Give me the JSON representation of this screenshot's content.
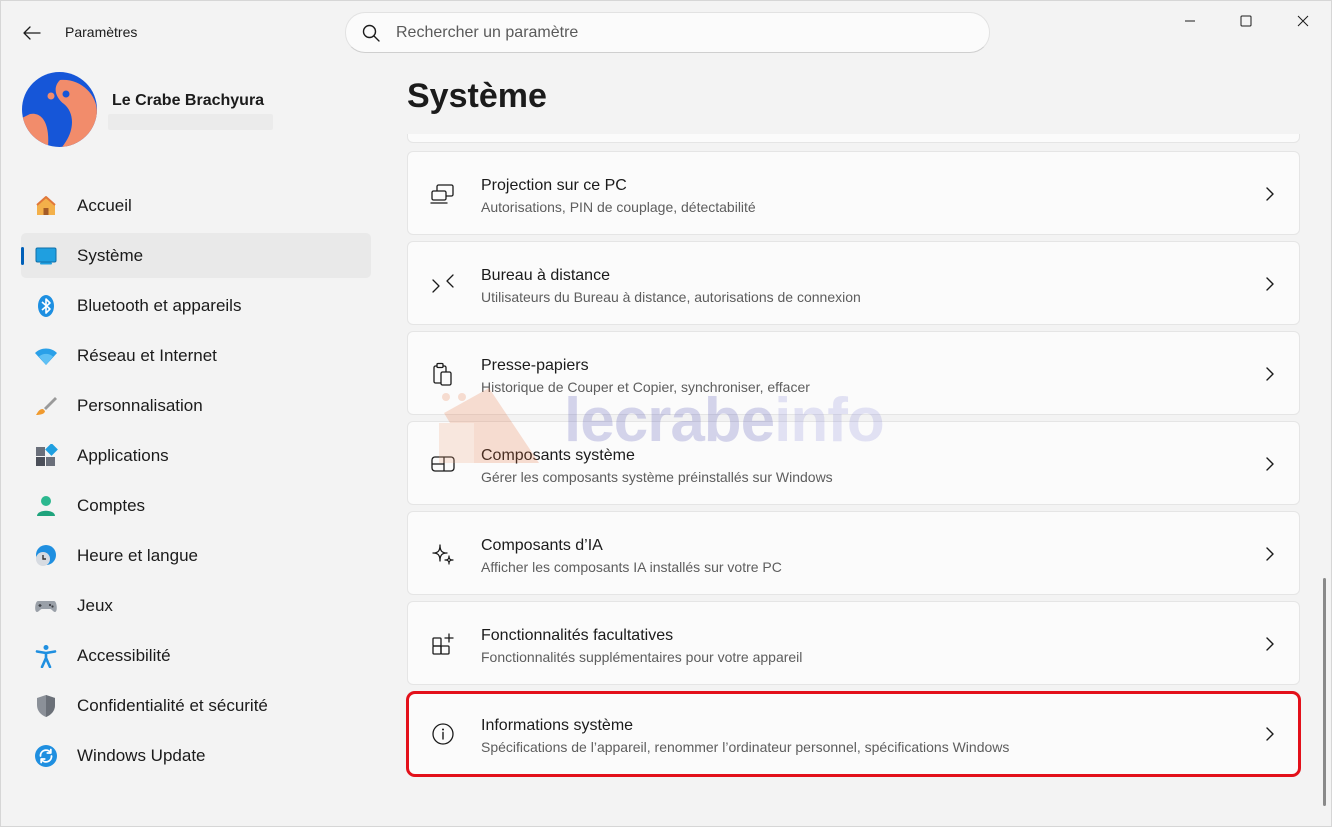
{
  "titlebar": {
    "app_title": "Paramètres",
    "search_placeholder": "Rechercher un paramètre"
  },
  "profile": {
    "name": "Le Crabe Brachyura"
  },
  "nav": {
    "items": [
      {
        "label": "Accueil",
        "icon": "home-icon"
      },
      {
        "label": "Système",
        "icon": "system-icon",
        "active": true
      },
      {
        "label": "Bluetooth et appareils",
        "icon": "bluetooth-icon"
      },
      {
        "label": "Réseau et Internet",
        "icon": "wifi-icon"
      },
      {
        "label": "Personnalisation",
        "icon": "brush-icon"
      },
      {
        "label": "Applications",
        "icon": "apps-icon"
      },
      {
        "label": "Comptes",
        "icon": "account-icon"
      },
      {
        "label": "Heure et langue",
        "icon": "clock-globe-icon"
      },
      {
        "label": "Jeux",
        "icon": "gamepad-icon"
      },
      {
        "label": "Accessibilité",
        "icon": "accessibility-icon"
      },
      {
        "label": "Confidentialité et sécurité",
        "icon": "shield-icon"
      },
      {
        "label": "Windows Update",
        "icon": "update-icon"
      }
    ]
  },
  "main": {
    "title": "Système",
    "cards": [
      {
        "title": "Projection sur ce PC",
        "subtitle": "Autorisations, PIN de couplage, détectabilité",
        "icon": "projection-icon"
      },
      {
        "title": "Bureau à distance",
        "subtitle": "Utilisateurs du Bureau à distance, autorisations de connexion",
        "icon": "remote-desktop-icon"
      },
      {
        "title": "Presse-papiers",
        "subtitle": "Historique de Couper et Copier, synchroniser, effacer",
        "icon": "clipboard-icon"
      },
      {
        "title": "Composants système",
        "subtitle": "Gérer les composants système préinstallés sur Windows",
        "icon": "components-icon"
      },
      {
        "title": "Composants d’IA",
        "subtitle": "Afficher les composants IA installés sur votre PC",
        "icon": "sparkle-icon"
      },
      {
        "title": "Fonctionnalités facultatives",
        "subtitle": "Fonctionnalités supplémentaires pour votre appareil",
        "icon": "add-apps-icon"
      },
      {
        "title": "Informations système",
        "subtitle": "Spécifications de l’appareil, renommer l’ordinateur personnel, spécifications Windows",
        "icon": "info-icon",
        "highlighted": true
      }
    ]
  },
  "watermark": {
    "text_a": "lecrabe",
    "text_b": "info"
  },
  "colors": {
    "accent": "#005fb8",
    "highlight": "#e3101a",
    "avatar_bg": "#1656d8",
    "avatar_shape": "#f28c6b"
  }
}
